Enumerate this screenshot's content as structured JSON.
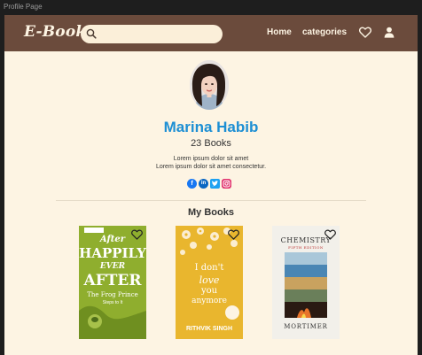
{
  "window": {
    "title": "Profile Page"
  },
  "header": {
    "logo": "E-Books",
    "search": {
      "placeholder": "",
      "value": ""
    },
    "nav": {
      "home": "Home",
      "categories": "categories"
    },
    "icons": {
      "favorites": "heart-icon",
      "account": "user-icon"
    }
  },
  "profile": {
    "name": "Marina Habib",
    "books_count": "23 Books",
    "bio_line1": "Lorem ipsum dolor sit amet",
    "bio_line2": "Lorem ipsum dolor sit amet consectetur.",
    "socials": [
      "facebook-icon",
      "linkedin-icon",
      "twitter-icon",
      "instagram-icon"
    ]
  },
  "section": {
    "my_books": "My Books"
  },
  "books": [
    {
      "cover_lines": [
        "After",
        "HAPPILY",
        "EVER",
        "AFTER"
      ],
      "subtitle": "The Frog Prince",
      "tagline": "Steps to It",
      "cover_color": "#8fae2e"
    },
    {
      "cover_lines": [
        "I don't",
        "love",
        "you",
        "anymore"
      ],
      "author": "RITHVIK SINGH",
      "cover_color": "#e9b62e"
    },
    {
      "cover_lines": [
        "CHEMISTRY",
        "FIFTH EDITION"
      ],
      "author": "MORTIMER",
      "cover_color": "#f2f0ea"
    }
  ],
  "colors": {
    "header_bg": "#6b4b3c",
    "page_bg": "#fdf4e3",
    "accent": "#1d8fd4"
  }
}
